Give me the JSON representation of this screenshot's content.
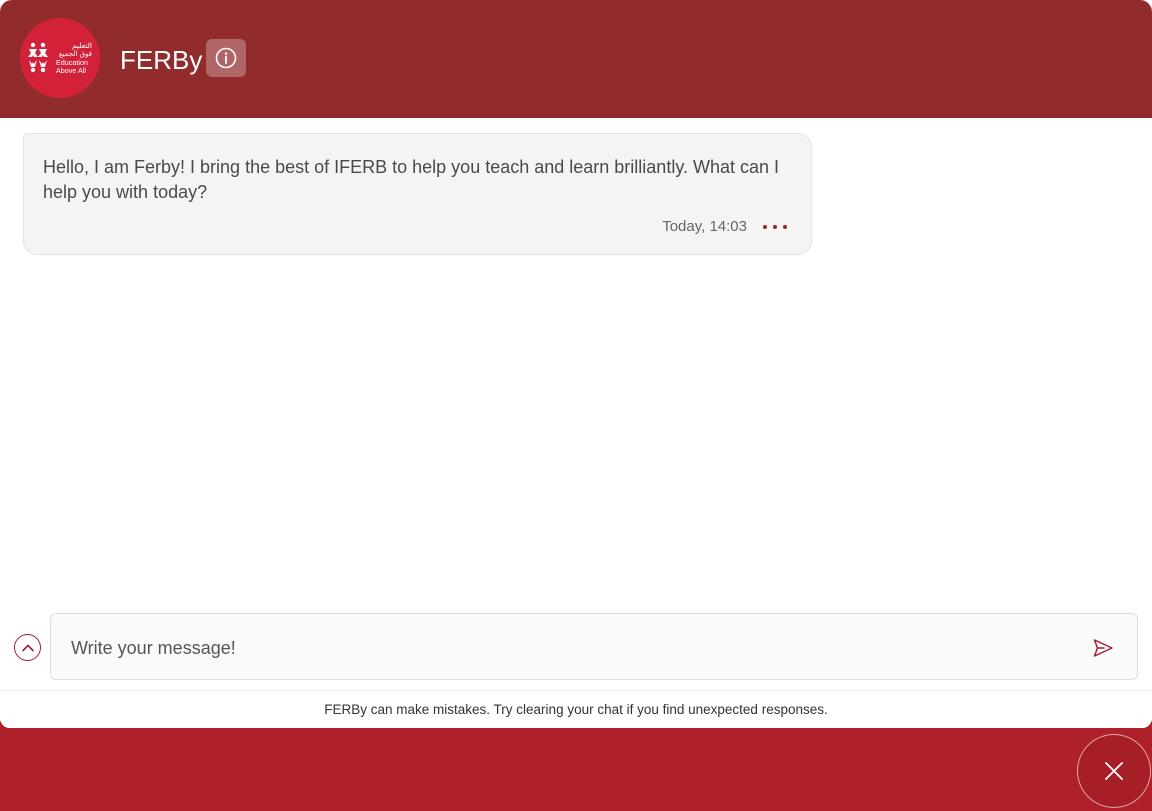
{
  "header": {
    "bot_name": "FERBy",
    "logo_text_arabic_line1": "التعليم",
    "logo_text_arabic_line2": "فوق الجميع",
    "logo_text_line1": "Education",
    "logo_text_line2": "Above All"
  },
  "messages": [
    {
      "text": "Hello, I am Ferby! I bring the best of IFERB to help you teach and learn brilliantly. What can I help you with today?",
      "timestamp": "Today, 14:03"
    }
  ],
  "composer": {
    "placeholder": "Write your message!",
    "value": ""
  },
  "footer": {
    "disclaimer": "FERBy can make mistakes. Try clearing your chat if you find unexpected responses."
  },
  "icons": {
    "info": "info-icon",
    "more": "more-icon",
    "expand": "chevron-up-icon",
    "send": "send-icon",
    "close": "close-icon"
  },
  "colors": {
    "header_bg": "#922b2b",
    "logo_bg": "#d4213a",
    "accent": "#a02030",
    "page_bg": "#b0202a",
    "bubble_bg": "#f4f4f4"
  }
}
